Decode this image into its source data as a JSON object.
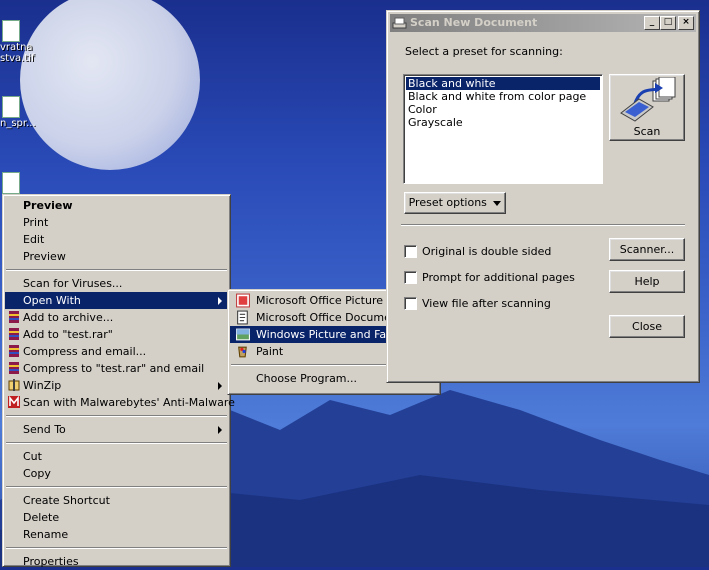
{
  "desktop": {
    "icons": [
      {
        "name": "desktop-icon-tif",
        "label": "vratna\nstva.tif"
      },
      {
        "name": "desktop-icon-spr",
        "label": "n_spr..."
      }
    ]
  },
  "context_menu": {
    "items": [
      {
        "label": "Preview",
        "bold": true
      },
      {
        "label": "Print"
      },
      {
        "label": "Edit"
      },
      {
        "label": "Preview"
      },
      {
        "sep": true
      },
      {
        "label": "Scan for Viruses..."
      },
      {
        "label": "Open With",
        "submenu": true,
        "highlighted": true
      },
      {
        "label": "Add to archive...",
        "icon": "winrar-icon"
      },
      {
        "label": "Add to \"test.rar\"",
        "icon": "winrar-icon"
      },
      {
        "label": "Compress and email...",
        "icon": "winrar-icon"
      },
      {
        "label": "Compress to \"test.rar\" and email",
        "icon": "winrar-icon"
      },
      {
        "label": "WinZip",
        "icon": "winzip-icon",
        "submenu": true
      },
      {
        "label": "Scan with Malwarebytes' Anti-Malware",
        "icon": "malwarebytes-icon"
      },
      {
        "sep": true
      },
      {
        "label": "Send To",
        "submenu": true
      },
      {
        "sep": true
      },
      {
        "label": "Cut"
      },
      {
        "label": "Copy"
      },
      {
        "sep": true
      },
      {
        "label": "Create Shortcut"
      },
      {
        "label": "Delete"
      },
      {
        "label": "Rename"
      },
      {
        "sep": true
      },
      {
        "label": "Properties"
      }
    ]
  },
  "submenu": {
    "items": [
      {
        "label": "Microsoft Office Picture Manager",
        "icon": "picture-manager-icon"
      },
      {
        "label": "Microsoft Office Document Imaging",
        "icon": "document-imaging-icon"
      },
      {
        "label": "Windows Picture and Fax Viewer",
        "icon": "picture-fax-viewer-icon",
        "highlighted": true
      },
      {
        "label": "Paint",
        "icon": "paint-icon"
      },
      {
        "sep": true
      },
      {
        "label": "Choose Program..."
      }
    ]
  },
  "dialog": {
    "title": "Scan New Document",
    "preset_label": "Select a preset for scanning:",
    "presets": [
      "Black and white",
      "Black and white from color page",
      "Color",
      "Grayscale"
    ],
    "selected_preset": 0,
    "scan_button": "Scan",
    "preset_options_button": "Preset options",
    "checkbox_double_sided": "Original is double sided",
    "checkbox_prompt": "Prompt for additional pages",
    "checkbox_view": "View file after scanning",
    "scanner_button": "Scanner...",
    "help_button": "Help",
    "close_button": "Close"
  }
}
